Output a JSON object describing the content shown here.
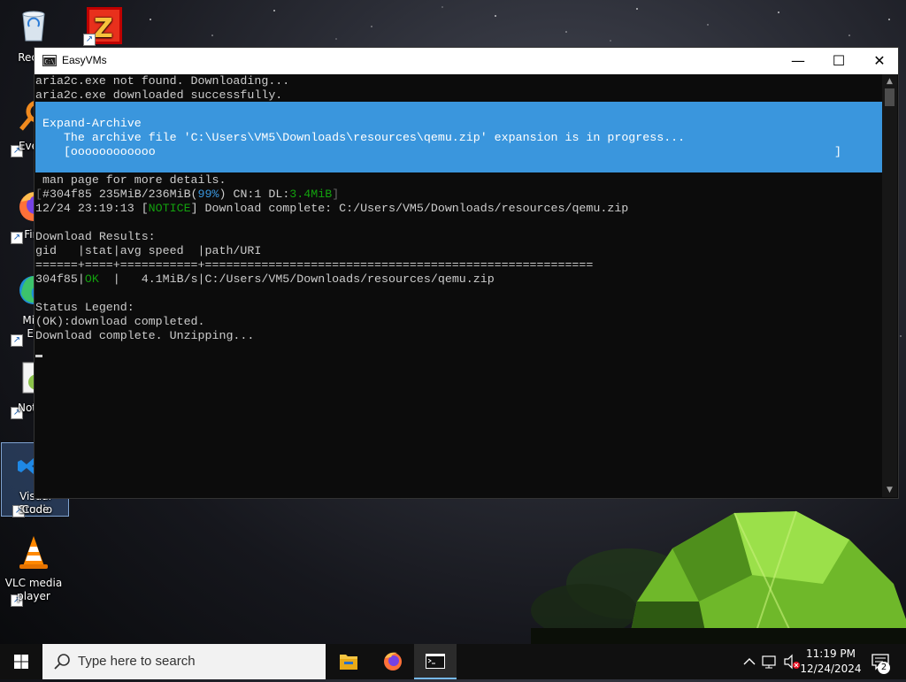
{
  "desktop": {
    "icons": [
      {
        "label": "Recycle Bin",
        "visible_label": "Recyc"
      },
      {
        "label": "FileZilla"
      },
      {
        "label": "Everything",
        "visible_label": "Every"
      },
      {
        "label": "Firefox",
        "visible_label": "Fire"
      },
      {
        "label": "Microsoft Edge",
        "visible_label_1": "Micr",
        "visible_label_2": "Ed"
      },
      {
        "label": "Notepad++",
        "visible_label": "Notep"
      },
      {
        "label": "Visual Studio Code",
        "visible_label_1": "Visual Studio",
        "visible_label_2": "Code"
      },
      {
        "label": "VLC media player",
        "visible_label_1": "VLC media",
        "visible_label_2": "player"
      }
    ]
  },
  "window": {
    "title": "EasyVMs",
    "controls": {
      "minimize": "—",
      "maximize": "☐",
      "close": "✕"
    }
  },
  "console": {
    "line1": "aria2c.exe not found. Downloading...",
    "line2": "aria2c.exe downloaded successfully.",
    "progress": {
      "cmdlet": "Expand-Archive",
      "message": "   The archive file 'C:\\Users\\VM5\\Downloads\\resources\\qemu.zip' expansion is in progress...",
      "bar_open": "   [",
      "bar_fill": "oooooooooooo",
      "bar_close": "]"
    },
    "man_line": " man page for more details.",
    "status": {
      "open": "[",
      "id": "#304f85 235MiB/236MiB(",
      "pct": "99%",
      "mid": ") CN:1 DL:",
      "speed": "3.4MiB",
      "close": "]"
    },
    "notice": {
      "pre": "12/24 23:19:13 [",
      "tag": "NOTICE",
      "post": "] Download complete: C:/Users/VM5/Downloads/resources/qemu.zip"
    },
    "results_header": "Download Results:",
    "table_header": "gid   |stat|avg speed  |path/URI",
    "table_rule": "======+====+===========+=======================================================",
    "row": {
      "gid": "304f85",
      "sep1": "|",
      "stat": "OK",
      "rest": "  |   4.1MiB/s|C:/Users/VM5/Downloads/resources/qemu.zip"
    },
    "legend_header": "Status Legend:",
    "legend_line": "(OK):download completed.",
    "final_line": "Download complete. Unzipping..."
  },
  "taskbar": {
    "search_placeholder": "Type here to search",
    "apps": [
      "File Explorer",
      "Firefox",
      "Command Prompt"
    ],
    "time": "11:19 PM",
    "date": "12/24/2024",
    "notification_count": "2"
  }
}
